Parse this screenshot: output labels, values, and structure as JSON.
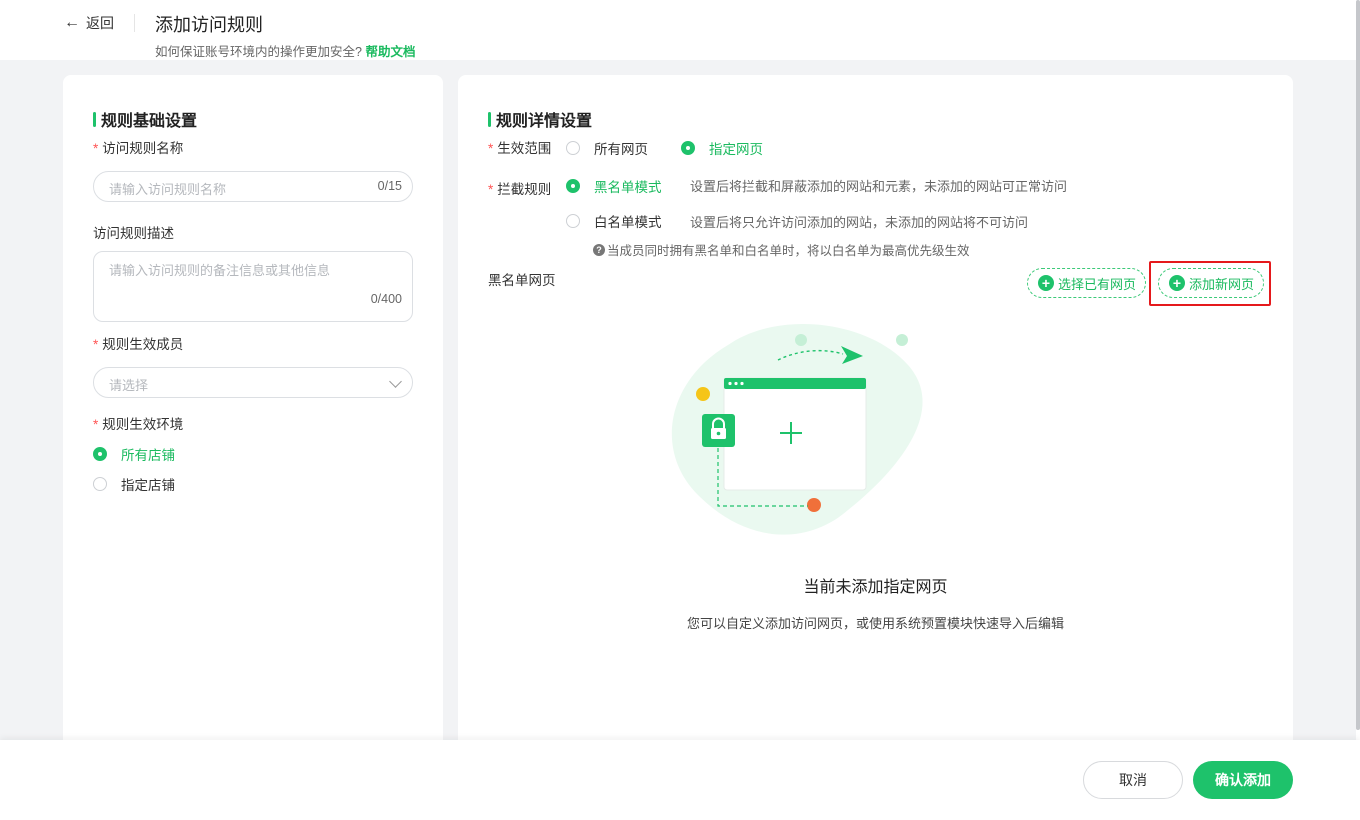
{
  "header": {
    "back_label": "返回",
    "title": "添加访问规则",
    "subtitle": "如何保证账号环境内的操作更加安全?",
    "help_link": "帮助文档"
  },
  "left": {
    "section_title": "规则基础设置",
    "name_label": "访问规则名称",
    "name_placeholder": "请输入访问规则名称",
    "name_count": "0/15",
    "desc_label": "访问规则描述",
    "desc_placeholder": "请输入访问规则的备注信息或其他信息",
    "desc_count": "0/400",
    "members_label": "规则生效成员",
    "members_placeholder": "请选择",
    "env_label": "规则生效环境",
    "env_options": [
      "所有店铺",
      "指定店铺"
    ],
    "env_selected": "所有店铺"
  },
  "right": {
    "section_title": "规则详情设置",
    "scope_label": "生效范围",
    "scope_options": [
      "所有网页",
      "指定网页"
    ],
    "scope_selected": "指定网页",
    "intercept_label": "拦截规则",
    "blacklist_mode": "黑名单模式",
    "blacklist_desc": "设置后将拦截和屏蔽添加的网站和元素，未添加的网站可正常访问",
    "whitelist_mode": "白名单模式",
    "whitelist_desc": "设置后将只允许访问添加的网站，未添加的网站将不可访问",
    "mode_selected": "黑名单模式",
    "hint": "当成员同时拥有黑名单和白名单时，将以白名单为最高优先级生效",
    "list_label": "黑名单网页",
    "select_existing_button": "选择已有网页",
    "add_new_button": "添加新网页",
    "empty_title": "当前未添加指定网页",
    "empty_desc": "您可以自定义添加访问网页，或使用系统预置模块快速导入后编辑"
  },
  "footer": {
    "cancel_label": "取消",
    "confirm_label": "确认添加"
  },
  "colors": {
    "accent": "#1ec26b",
    "highlight_frame": "#e5191c"
  }
}
